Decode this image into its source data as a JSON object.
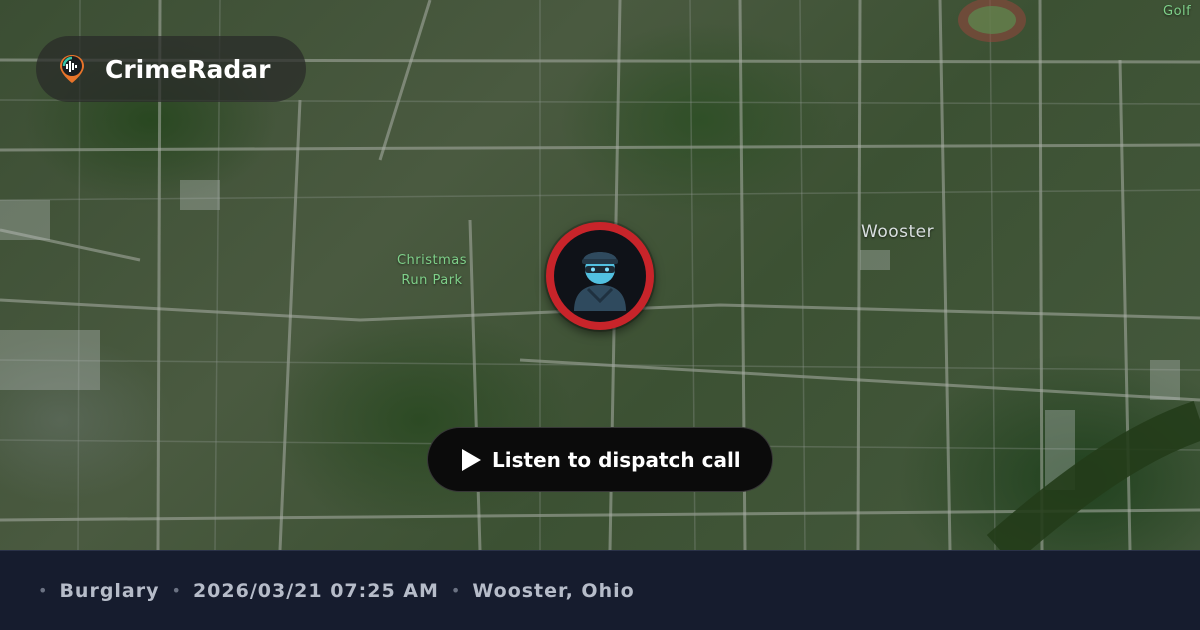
{
  "app": {
    "name": "CrimeRadar",
    "logo_icon": "radar-pin-icon"
  },
  "map": {
    "labels": {
      "park_line1": "Christmas",
      "park_line2": "Run Park",
      "city": "Wooster",
      "corner": "Golf"
    },
    "marker_icon": "burglar-icon",
    "colors": {
      "marker_ring": "#c8242a",
      "park_label": "#7fd18a"
    }
  },
  "player": {
    "label": "Listen to dispatch call",
    "icon": "play-icon"
  },
  "footer": {
    "crime_type": "Burglary",
    "datetime": "2026/03/21 07:25 AM",
    "location": "Wooster, Ohio",
    "separator": "•"
  }
}
